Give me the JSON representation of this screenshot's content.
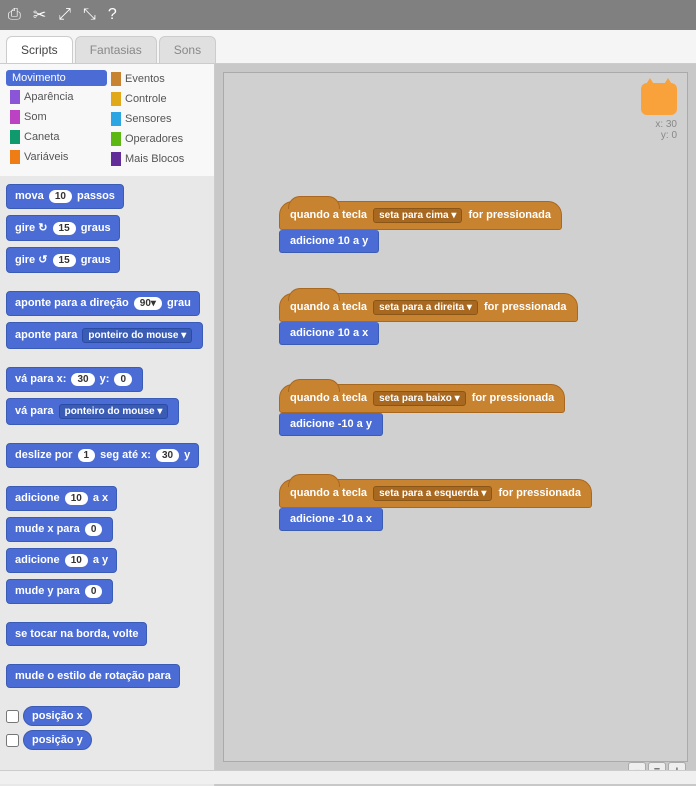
{
  "toolbar_icons": [
    "stamp",
    "cut",
    "expand",
    "shrink",
    "help"
  ],
  "tabs": {
    "scripts": "Scripts",
    "costumes": "Fantasias",
    "sounds": "Sons"
  },
  "categories": {
    "motion": {
      "label": "Movimento",
      "color": "#4a6cd4"
    },
    "looks": {
      "label": "Aparência",
      "color": "#8a55d7"
    },
    "sound": {
      "label": "Som",
      "color": "#bb42c3"
    },
    "pen": {
      "label": "Caneta",
      "color": "#0e9a6c"
    },
    "variables": {
      "label": "Variáveis",
      "color": "#ee7d16"
    },
    "events": {
      "label": "Eventos",
      "color": "#c88330"
    },
    "control": {
      "label": "Controle",
      "color": "#e1a91a"
    },
    "sensing": {
      "label": "Sensores",
      "color": "#2ca5e2"
    },
    "operators": {
      "label": "Operadores",
      "color": "#5cb712"
    },
    "more": {
      "label": "Mais Blocos",
      "color": "#632d99"
    }
  },
  "palette": {
    "move": {
      "pre": "mova",
      "val": "10",
      "post": "passos"
    },
    "turn_cw": {
      "pre": "gire ↻",
      "val": "15",
      "post": "graus"
    },
    "turn_ccw": {
      "pre": "gire ↺",
      "val": "15",
      "post": "graus"
    },
    "point_dir": {
      "pre": "aponte para a direção",
      "val": "90▾",
      "post": "grau"
    },
    "point_to": {
      "pre": "aponte para",
      "drop": "ponteiro do mouse ▾"
    },
    "goto_xy": {
      "pre": "vá para x:",
      "x": "30",
      "mid": "y:",
      "y": "0"
    },
    "goto_obj": {
      "pre": "vá para",
      "drop": "ponteiro do mouse ▾"
    },
    "glide": {
      "pre": "deslize por",
      "sec": "1",
      "mid": "seg até x:",
      "x": "30",
      "post": "y"
    },
    "change_x": {
      "pre": "adicione",
      "val": "10",
      "post": "a x"
    },
    "set_x": {
      "pre": "mude x para",
      "val": "0"
    },
    "change_y": {
      "pre": "adicione",
      "val": "10",
      "post": "a y"
    },
    "set_y": {
      "pre": "mude y para",
      "val": "0"
    },
    "bounce": "se tocar na borda, volte",
    "rot_style": "mude o estilo de rotação para",
    "pos_x": "posição x",
    "pos_y": "posição y"
  },
  "sprite": {
    "x_label": "x:",
    "x": "30",
    "y_label": "y:",
    "y": "0"
  },
  "scripts": {
    "hat_pre": "quando a tecla",
    "hat_post": "for pressionada",
    "key_up": "seta para cima ▾",
    "key_right": "seta para a direita ▾",
    "key_down": "seta para baixo ▾",
    "key_left": "seta para a esquerda ▾",
    "add_pre": "adicione",
    "to_y": "a y",
    "to_x": "a x",
    "v10": "10",
    "vn10": "-10"
  },
  "zoom": {
    "out": "−",
    "eq": "=",
    "in": "+"
  }
}
